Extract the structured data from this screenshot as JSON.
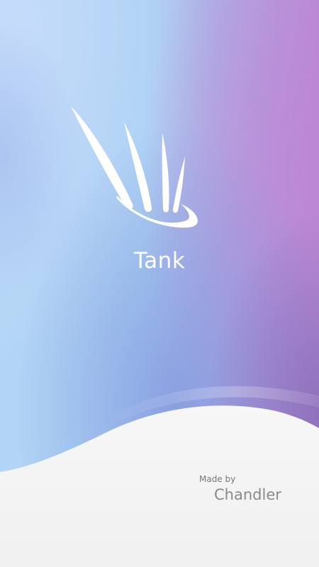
{
  "app": {
    "name": "Tank",
    "logo_icon": "raised-hand-icon"
  },
  "footer": {
    "made_by_label": "Made by",
    "author": "Chandler"
  },
  "colors": {
    "gradient_left": "#b4d6f6",
    "gradient_top_left": "#c2d9fb",
    "gradient_right": "#b98cd8",
    "bottom_purple": "#8d79c4",
    "wave_fill": "#f2f2f2",
    "text_white": "#ffffff",
    "text_gray": "#8a8a8a"
  }
}
